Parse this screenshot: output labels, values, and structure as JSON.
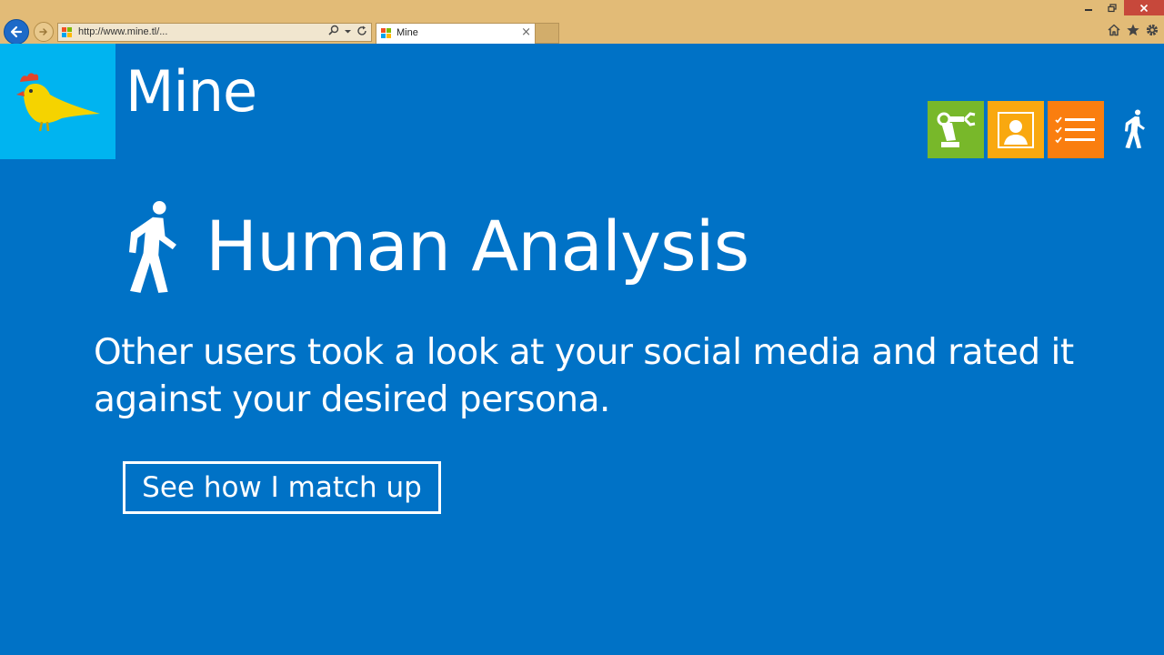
{
  "browser": {
    "address_url": "http://www.mine.tl/...",
    "tab_title": "Mine",
    "tab_close": "×",
    "icons": [
      "back-arrow-icon",
      "forward-arrow-icon",
      "search-icon",
      "refresh-icon",
      "home-icon",
      "favorites-star-icon",
      "settings-gear-icon",
      "minimize-icon",
      "restore-icon",
      "close-icon"
    ]
  },
  "app": {
    "title": "Mine",
    "logo_icon": "canary-bird-icon",
    "nav_tiles": [
      {
        "name": "robot-analysis",
        "icon": "robot-arm-icon",
        "color": "#78b82a"
      },
      {
        "name": "profile",
        "icon": "profile-card-icon",
        "color": "#f9a80f"
      },
      {
        "name": "checklist",
        "icon": "checklist-icon",
        "color": "#fa7e0f"
      },
      {
        "name": "human-analysis",
        "icon": "walking-person-icon",
        "color": "#ffffff"
      }
    ]
  },
  "main": {
    "heading": "Human Analysis",
    "heading_icon": "walking-person-icon",
    "description": "Other users took a look at your social media and rated it against your desired persona.",
    "cta_label": "See how I match up"
  },
  "colors": {
    "background": "#0072c6",
    "chrome": "#e2bb77",
    "logo_tile": "#00b4f0",
    "bird": "#f5d300",
    "text": "#ffffff"
  }
}
